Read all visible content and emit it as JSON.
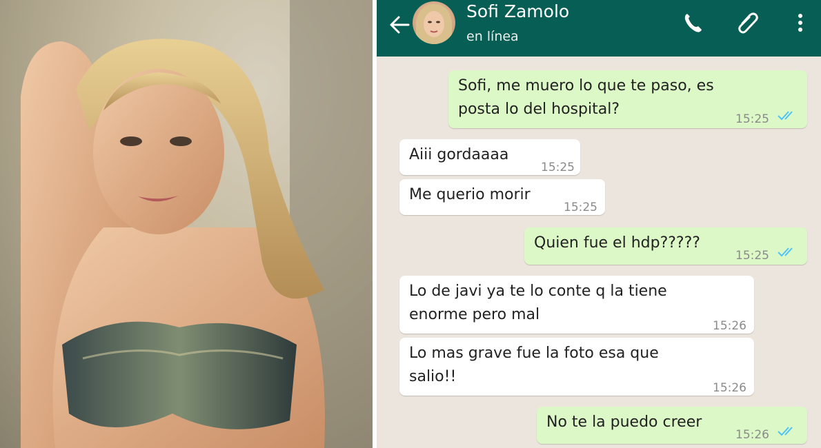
{
  "contact": {
    "name": "Sofi Zamolo",
    "status": "en línea"
  },
  "header_icons": [
    "back-arrow-icon",
    "phone-icon",
    "paperclip-icon",
    "more-vert-icon"
  ],
  "colors": {
    "header": "#075e54",
    "chat_bg": "#ece5dd",
    "outgoing": "#dcf8c6",
    "incoming": "#ffffff",
    "read_ticks": "#4fc3f7"
  },
  "messages": [
    {
      "dir": "out",
      "lines": [
        "Sofi, me muero lo que te paso, es",
        "posta lo del hospital?"
      ],
      "time": "15:25",
      "read": true
    },
    {
      "dir": "in",
      "lines": [
        "Aiii gordaaaa"
      ],
      "time": "15:25"
    },
    {
      "dir": "in",
      "lines": [
        "Me querio morir"
      ],
      "time": "15:25"
    },
    {
      "dir": "out",
      "lines": [
        "Quien fue el hdp?????"
      ],
      "time": "15:25",
      "read": true
    },
    {
      "dir": "in",
      "lines": [
        "Lo de javi ya te lo conte q la tiene",
        "enorme pero mal"
      ],
      "time": "15:26"
    },
    {
      "dir": "in",
      "lines": [
        "Lo mas grave fue la foto esa que",
        "salio!!"
      ],
      "time": "15:26"
    },
    {
      "dir": "out",
      "lines": [
        "No te la puedo creer"
      ],
      "time": "15:26",
      "read": true
    }
  ]
}
